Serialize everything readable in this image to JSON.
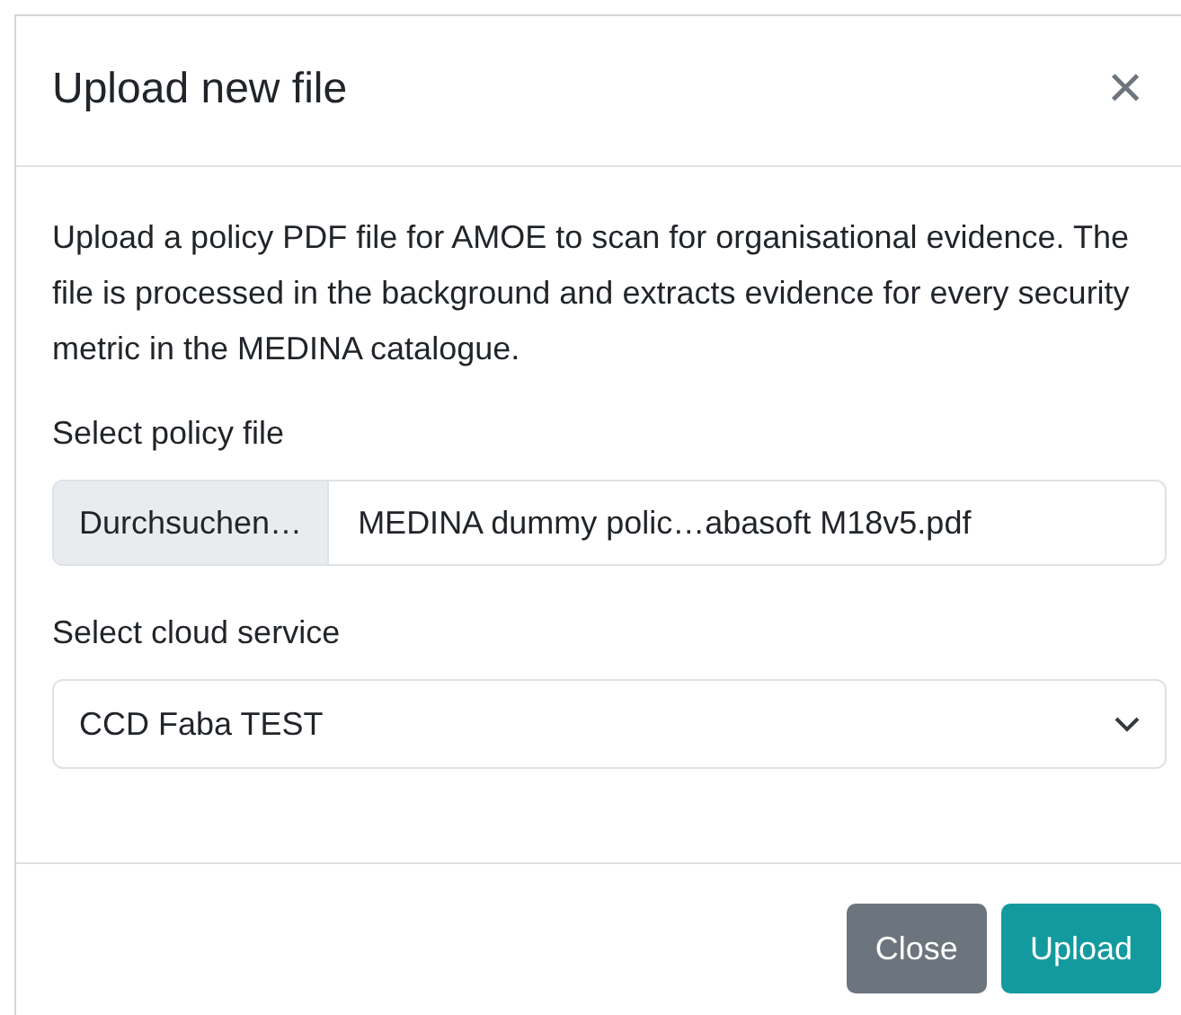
{
  "dialog": {
    "title": "Upload new file",
    "close_icon": "×"
  },
  "description": "Upload a policy PDF file for AMOE to scan for organisational evidence. The file is processed in the background and extracts evidence for every security metric in the MEDINA catalogue.",
  "policy_file": {
    "label": "Select policy file",
    "button": "Durchsuchen…",
    "value": "MEDINA dummy polic…abasoft M18v5.pdf"
  },
  "cloud_service": {
    "label": "Select cloud service",
    "value": "CCD Faba TEST"
  },
  "buttons": [
    {
      "label": "Close",
      "kind": "secondary"
    },
    {
      "label": "Upload",
      "kind": "primary"
    }
  ]
}
